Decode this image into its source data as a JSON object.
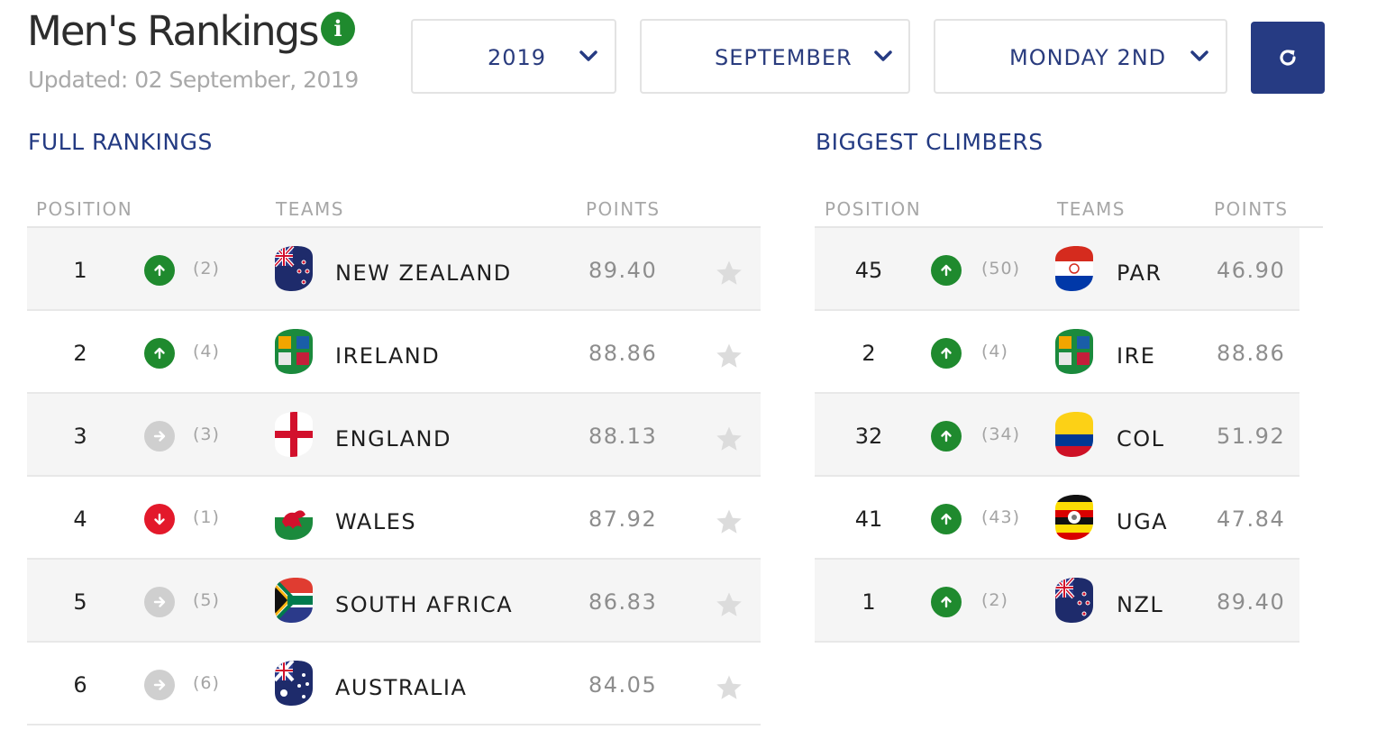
{
  "header": {
    "title": "Men's Rankings",
    "info_icon": "info-icon",
    "updated": "Updated: 02 September, 2019"
  },
  "filters": {
    "year": "2019",
    "month": "SEPTEMBER",
    "day": "MONDAY 2ND",
    "refresh_icon": "refresh-icon"
  },
  "full_rankings": {
    "title": "FULL RANKINGS",
    "columns": {
      "position": "POSITION",
      "teams": "TEAMS",
      "points": "POINTS"
    },
    "rows": [
      {
        "position": "1",
        "movement": "up",
        "previous": "(2)",
        "team": "NEW ZEALAND",
        "flag": "nzl",
        "points": "89.40"
      },
      {
        "position": "2",
        "movement": "up",
        "previous": "(4)",
        "team": "IRELAND",
        "flag": "ire",
        "points": "88.86"
      },
      {
        "position": "3",
        "movement": "same",
        "previous": "(3)",
        "team": "ENGLAND",
        "flag": "eng",
        "points": "88.13"
      },
      {
        "position": "4",
        "movement": "down",
        "previous": "(1)",
        "team": "WALES",
        "flag": "wal",
        "points": "87.92"
      },
      {
        "position": "5",
        "movement": "same",
        "previous": "(5)",
        "team": "SOUTH AFRICA",
        "flag": "rsa",
        "points": "86.83"
      },
      {
        "position": "6",
        "movement": "same",
        "previous": "(6)",
        "team": "AUSTRALIA",
        "flag": "aus",
        "points": "84.05"
      }
    ]
  },
  "biggest_climbers": {
    "title": "BIGGEST CLIMBERS",
    "columns": {
      "position": "POSITION",
      "teams": "TEAMS",
      "points": "POINTS"
    },
    "rows": [
      {
        "position": "45",
        "movement": "up",
        "previous": "(50)",
        "team": "PAR",
        "flag": "par",
        "points": "46.90"
      },
      {
        "position": "2",
        "movement": "up",
        "previous": "(4)",
        "team": "IRE",
        "flag": "ire",
        "points": "88.86"
      },
      {
        "position": "32",
        "movement": "up",
        "previous": "(34)",
        "team": "COL",
        "flag": "col",
        "points": "51.92"
      },
      {
        "position": "41",
        "movement": "up",
        "previous": "(43)",
        "team": "UGA",
        "flag": "uga",
        "points": "47.84"
      },
      {
        "position": "1",
        "movement": "up",
        "previous": "(2)",
        "team": "NZL",
        "flag": "nzl",
        "points": "89.40"
      }
    ]
  },
  "colors": {
    "brand_navy": "#263b83",
    "up": "#1f8a2e",
    "down": "#e3192b",
    "same": "#cfcfcf"
  }
}
